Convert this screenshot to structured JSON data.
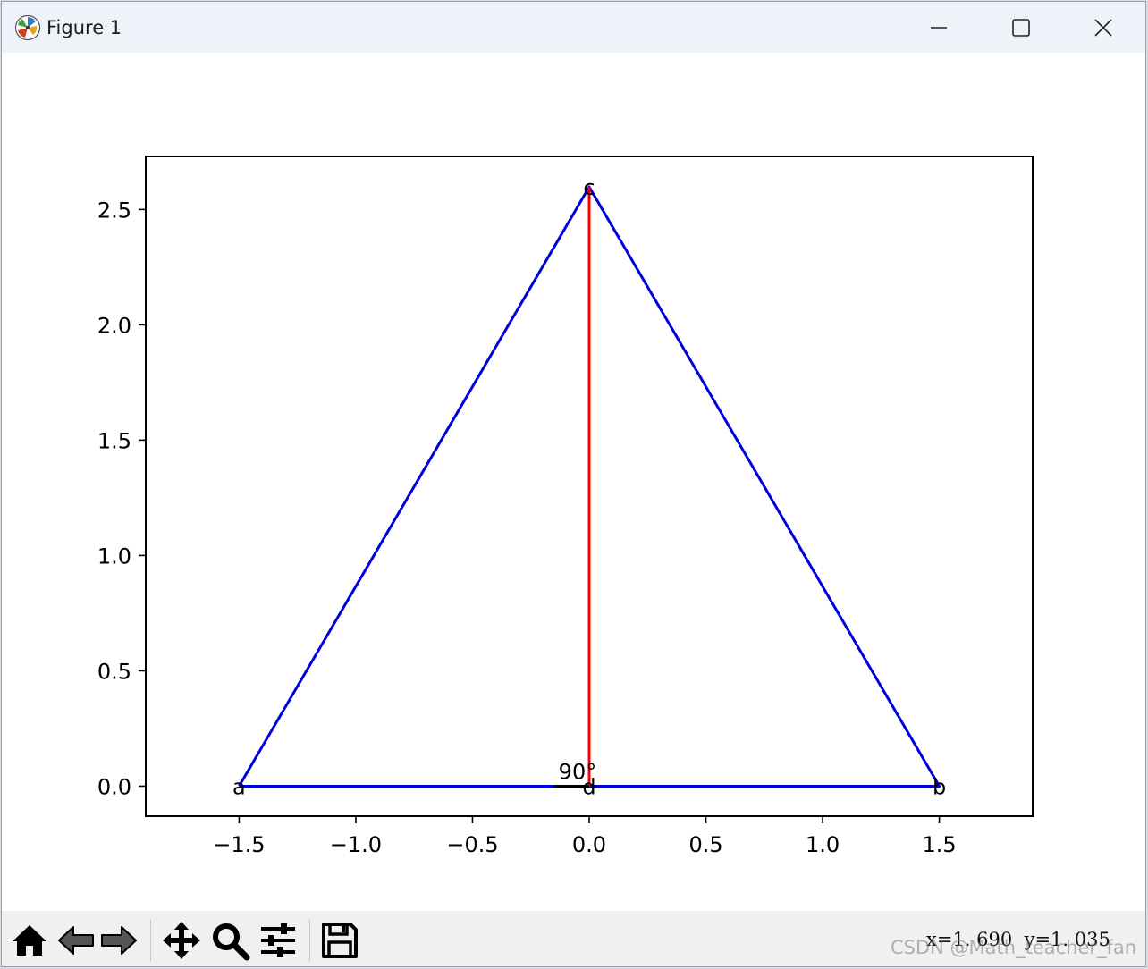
{
  "window": {
    "title": "Figure 1",
    "icon": "matplotlib-logo-icon",
    "controls": [
      "minimize-icon",
      "maximize-icon",
      "close-icon"
    ]
  },
  "chart_data": {
    "type": "line",
    "xlim": [
      -1.9,
      1.9
    ],
    "ylim": [
      -0.13,
      2.73
    ],
    "xticks": [
      -1.5,
      -1.0,
      -0.5,
      0.0,
      0.5,
      1.0,
      1.5
    ],
    "xtick_labels": [
      "−1.5",
      "−1.0",
      "−0.5",
      "0.0",
      "0.5",
      "1.0",
      "1.5"
    ],
    "yticks": [
      0.0,
      0.5,
      1.0,
      1.5,
      2.0,
      2.5
    ],
    "ytick_labels": [
      "0.0",
      "0.5",
      "1.0",
      "1.5",
      "2.0",
      "2.5"
    ],
    "grid": false,
    "series": [
      {
        "color": "#0000dd",
        "x": [
          -1.5,
          1.5,
          0.0,
          -1.5
        ],
        "y": [
          0.0,
          0.0,
          2.598,
          0.0
        ]
      },
      {
        "color": "#ff0000",
        "x": [
          0.0,
          0.0
        ],
        "y": [
          2.598,
          0.0
        ]
      },
      {
        "color": "#000000",
        "x": [
          -0.15,
          0.0
        ],
        "y": [
          0.0,
          0.0
        ]
      }
    ],
    "points": [
      {
        "label": "a",
        "x": -1.5,
        "y": 0.0
      },
      {
        "label": "b",
        "x": 1.5,
        "y": 0.0
      },
      {
        "label": "c",
        "x": 0.0,
        "y": 2.598
      },
      {
        "label": "d",
        "x": 0.0,
        "y": 0.0
      }
    ],
    "annotations": [
      {
        "text": "90°",
        "x": -0.05,
        "y": 0.03
      }
    ]
  },
  "toolbar": {
    "buttons": [
      "home-icon",
      "back-icon",
      "forward-icon",
      "pan-icon",
      "zoom-icon",
      "configure-subplots-icon",
      "save-icon"
    ],
    "coordinates": "x=1. 690  y=1. 035"
  },
  "watermark": "CSDN @Math_teacher_fan"
}
